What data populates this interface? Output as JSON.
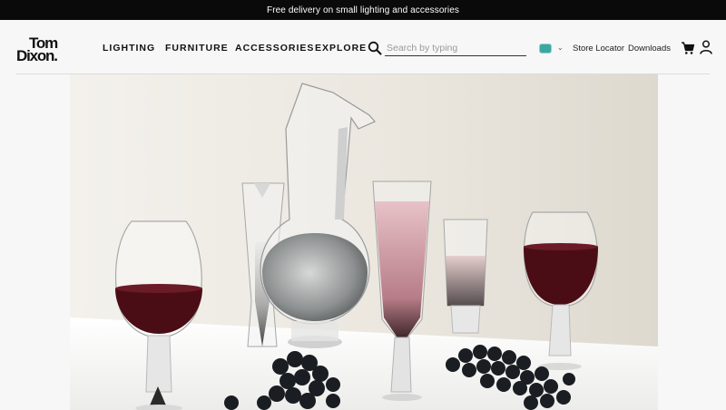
{
  "promo": {
    "text": "Free delivery on small lighting and accessories"
  },
  "brand": {
    "line1": "Tom",
    "line2": "Dixon."
  },
  "nav": [
    {
      "label": "LIGHTING"
    },
    {
      "label": "FURNITURE"
    },
    {
      "label": "ACCESSORIES"
    },
    {
      "label": "EXPLORE"
    }
  ],
  "search": {
    "placeholder": "Search by typing",
    "value": ""
  },
  "utility": {
    "store_locator": "Store Locator",
    "downloads": "Downloads"
  },
  "icons": {
    "search": "search-icon",
    "cart": "cart-icon",
    "account": "user-icon",
    "region": "region-flag-icon",
    "chevron": "chevron-down-icon"
  },
  "colors": {
    "promo_bg": "#0a0a0a",
    "page_bg": "#f7f7f7",
    "wine": "#4a0d16",
    "rose": "#d7a7b0"
  }
}
